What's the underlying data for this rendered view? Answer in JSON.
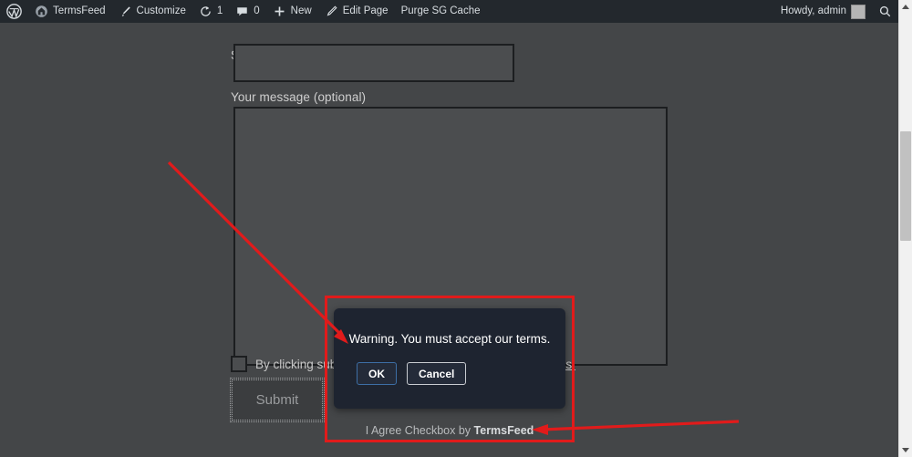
{
  "adminbar": {
    "items": [
      {
        "icon": "wordpress-logo-icon",
        "label": ""
      },
      {
        "icon": "home-icon",
        "label": "TermsFeed"
      },
      {
        "icon": "brush-icon",
        "label": "Customize"
      },
      {
        "icon": "revisions-icon",
        "label": "1"
      },
      {
        "icon": "comment-bubble-icon",
        "label": "0"
      },
      {
        "icon": "plus-icon",
        "label": "New"
      },
      {
        "icon": "pencil-icon",
        "label": "Edit Page"
      },
      {
        "icon": "",
        "label": "Purge SG Cache"
      }
    ],
    "greeting": "Howdy, admin",
    "search_icon": "search-icon",
    "avatar": "avatar"
  },
  "form": {
    "subject_label": "Subject",
    "subject_value": "",
    "subject_placeholder": "",
    "message_label": "Your message (optional)",
    "message_value": "",
    "message_placeholder": "",
    "consent_text_before": "By clicking submit, you agree to our ",
    "consent_link_text": "Terms and Conditions.",
    "consent_checked": false,
    "submit_label": "Submit"
  },
  "dialog": {
    "message": "Warning. You must accept our terms.",
    "ok_label": "OK",
    "cancel_label": "Cancel",
    "ok_border_color": "#3d6ea5",
    "cancel_border_color": "#c9ccd1",
    "background_color": "#1e2430"
  },
  "attribution": {
    "prefix": "I Agree Checkbox by ",
    "brand": "TermsFeed"
  },
  "annotations": {
    "highlight_color": "#e11b1b"
  },
  "scrollbar": {
    "up_arrow_icon": "chevron-up-icon",
    "down_arrow_icon": "chevron-down-icon"
  },
  "colors": {
    "page_background": "#444648",
    "adminbar_background": "#23282d"
  }
}
